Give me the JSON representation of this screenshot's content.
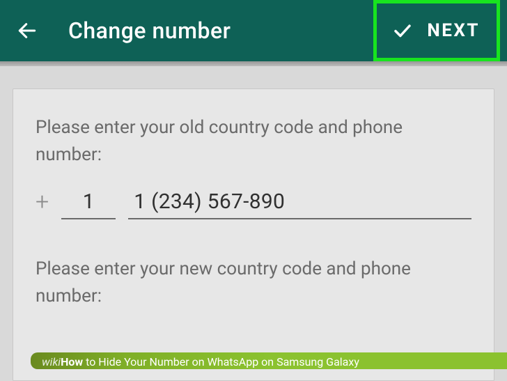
{
  "app_bar": {
    "title": "Change number",
    "next_label": "NEXT"
  },
  "form": {
    "old_prompt": "Please enter your old country code and phone number:",
    "plus": "+",
    "country_code": "1",
    "phone_number": "1 (234) 567-890",
    "new_prompt": "Please enter your new country code and phone number:"
  },
  "watermark": {
    "brand_prefix": "wiki",
    "brand_suffix": "How",
    "article": " to Hide Your Number on WhatsApp on Samsung Galaxy"
  },
  "colors": {
    "app_bar_bg": "#0e6156",
    "highlight_border": "#18e41f",
    "text_muted": "#6a6a6a"
  }
}
